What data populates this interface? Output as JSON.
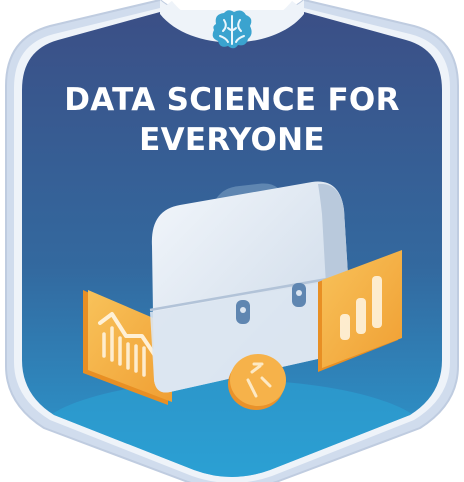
{
  "badge": {
    "title_line_1": "DATA SCIENCE FOR",
    "title_line_2": "EVERYONE",
    "top_icon": "brain-icon",
    "illustration": [
      "briefcase-icon",
      "line-chart-card",
      "bar-chart-card",
      "arrows-coin"
    ],
    "colors": {
      "frame_outer": "#c9d6e8",
      "frame_inner": "#eef3f9",
      "background_top": "#3b5189",
      "background_bottom": "#2c9ad1",
      "briefcase": "#dfe8f3",
      "card": "#f5b44a",
      "brain": "#3aa3cf"
    }
  }
}
